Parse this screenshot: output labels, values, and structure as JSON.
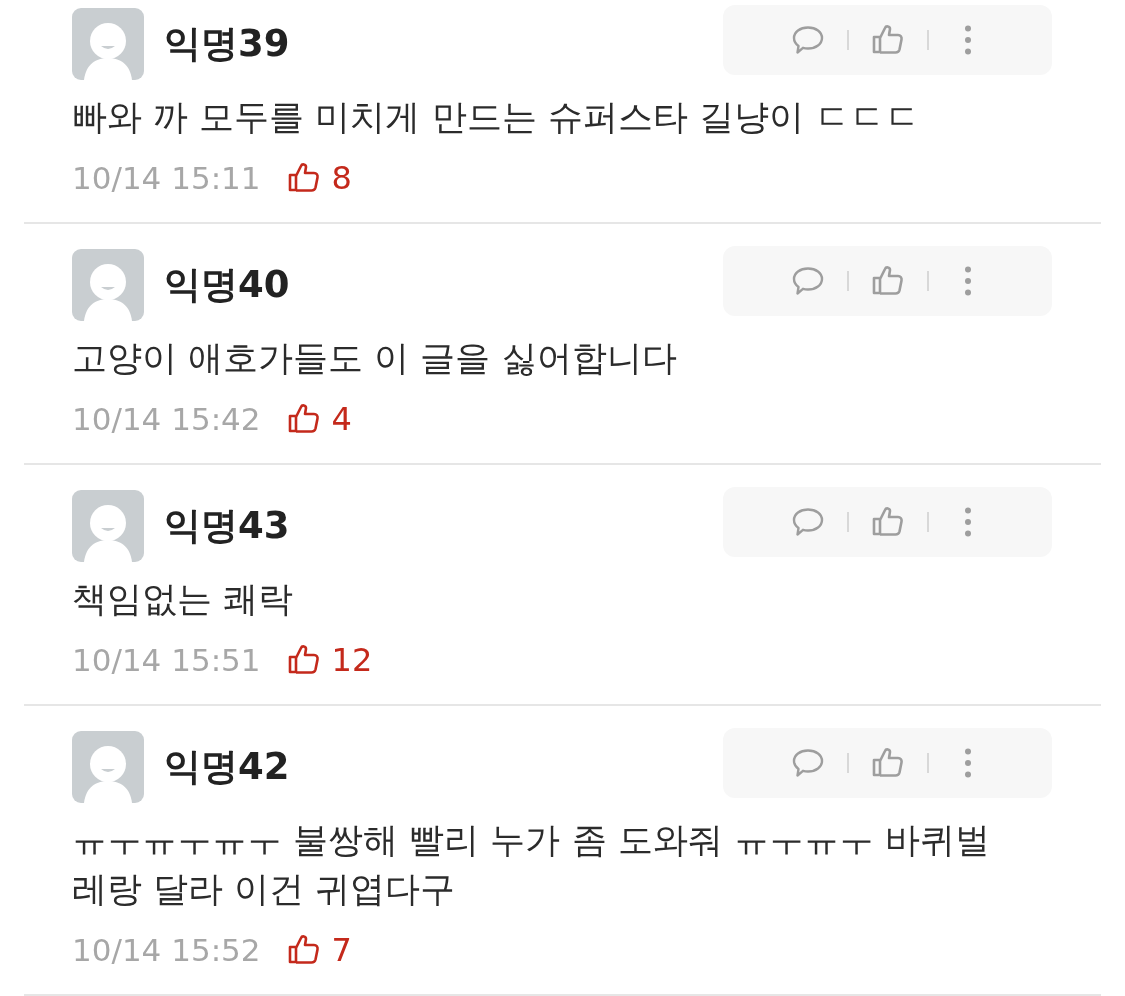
{
  "comments": [
    {
      "author": "익명39",
      "text": "빠와 까 모두를 미치게 만드는 슈퍼스타 길냥이 ㄷㄷㄷ",
      "time": "10/14 15:11",
      "likes": "8"
    },
    {
      "author": "익명40",
      "text": "고양이 애호가들도 이 글을 싫어합니다",
      "time": "10/14 15:42",
      "likes": "4"
    },
    {
      "author": "익명43",
      "text": "책임없는 쾌락",
      "time": "10/14 15:51",
      "likes": "12"
    },
    {
      "author": "익명42",
      "text": "ㅠㅜㅠㅜㅠㅜ 불쌍해 빨리 누가 좀 도와줘 ㅠㅜㅠㅜ 바퀴벌레랑 달라 이건 귀엽다구",
      "time": "10/14 15:52",
      "likes": "7"
    }
  ]
}
